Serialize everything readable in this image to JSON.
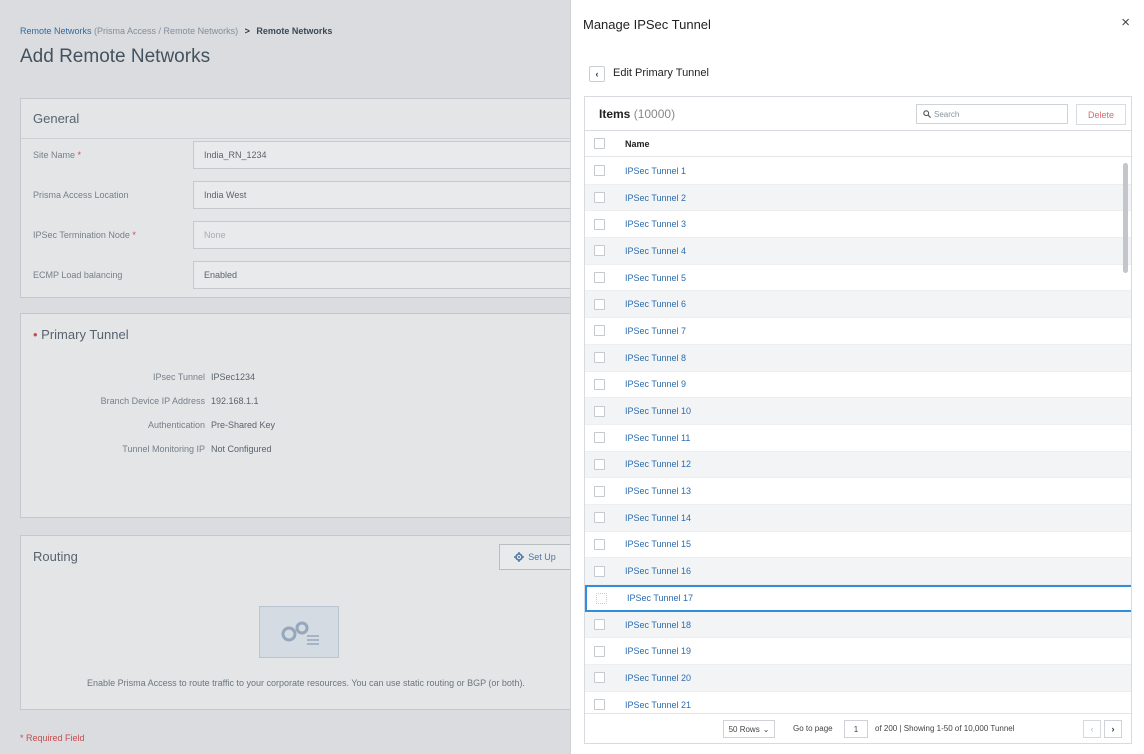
{
  "background": {
    "breadcrumb": {
      "link": "Remote Networks",
      "path": "(Prisma Access / Remote Networks)",
      "separator": ">",
      "current": "Remote Networks"
    },
    "page_title": "Add Remote Networks",
    "general": {
      "title": "General",
      "fields": [
        {
          "label": "Site Name",
          "required": true,
          "value": "India_RN_1234",
          "dropdown": false,
          "placeholder": false
        },
        {
          "label": "Prisma Access Location",
          "required": false,
          "value": "India West",
          "dropdown": true,
          "placeholder": false
        },
        {
          "label": "IPSec Termination Node",
          "required": true,
          "value": "None",
          "dropdown": true,
          "placeholder": true
        },
        {
          "label": "ECMP Load balancing",
          "required": false,
          "value": "Enabled",
          "dropdown": true,
          "placeholder": false
        }
      ]
    },
    "primary_tunnel": {
      "title": "Primary Tunnel",
      "props": [
        {
          "label": "IPsec Tunnel",
          "value": "IPSec1234"
        },
        {
          "label": "Branch Device IP Address",
          "value": "192.168.1.1"
        },
        {
          "label": "Authentication",
          "value": "Pre-Shared Key"
        },
        {
          "label": "Tunnel Monitoring IP",
          "value": "Not Configured"
        }
      ]
    },
    "routing": {
      "title": "Routing",
      "setup_label": "Set Up",
      "description": "Enable Prisma Access to route traffic to your corporate resources. You can use static routing or BGP (or both)."
    },
    "required_note": "* Required Field"
  },
  "panel": {
    "title": "Manage IPSec Tunnel",
    "close_glyph": "×",
    "back_glyph": "‹",
    "subtitle": "Edit Primary Tunnel",
    "items_label": "Items",
    "items_count": "(10000)",
    "search_placeholder": "Search",
    "delete_label": "Delete",
    "column_name": "Name",
    "selected_row": 16,
    "rows": [
      "IPSec Tunnel 1",
      "IPSec Tunnel 2",
      "IPSec Tunnel 3",
      "IPSec Tunnel 4",
      "IPSec Tunnel 5",
      "IPSec Tunnel 6",
      "IPSec Tunnel 7",
      "IPSec Tunnel 8",
      "IPSec Tunnel 9",
      "IPSec Tunnel 10",
      "IPSec Tunnel 11",
      "IPSec Tunnel 12",
      "IPSec Tunnel 13",
      "IPSec Tunnel 14",
      "IPSec Tunnel 15",
      "IPSec Tunnel 16",
      "IPSec Tunnel 17",
      "IPSec Tunnel 18",
      "IPSec Tunnel 19",
      "IPSec Tunnel 20",
      "IPSec Tunnel 21"
    ],
    "pager": {
      "rows_per_page": "50 Rows",
      "goto_label": "Go to page",
      "page_value": "1",
      "summary": "of 200 | Showing 1-50 of 10,000 Tunnel",
      "prev_glyph": "‹",
      "next_glyph": "›"
    }
  },
  "colors": {
    "link": "#2a6cb2",
    "selected_border": "#2f8fdd",
    "required": "#d94c4c",
    "delete_text": "#d36b6b"
  }
}
